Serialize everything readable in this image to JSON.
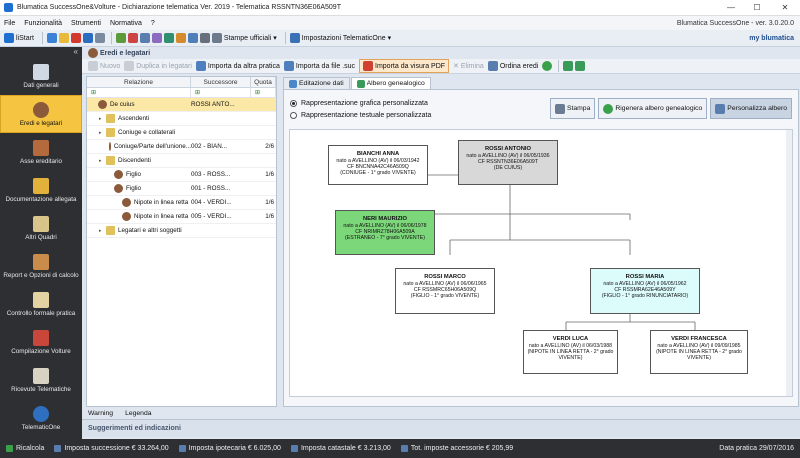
{
  "window": {
    "title": "Blumatica SuccessOne&Volture - Dichiarazione telematica Ver. 2019 - Telematica RSSNTN36E06A509T",
    "controls": {
      "minimize": "—",
      "maximize": "☐",
      "close": "✕"
    }
  },
  "menu": {
    "items": [
      "File",
      "Funzionalità",
      "Strumenti",
      "Normativa",
      "?"
    ],
    "version": "Blumatica SuccessOne - ver. 3.0.20.0"
  },
  "toolbar": {
    "start": "liStart",
    "stampe": "Stampe ufficiali",
    "impostazioni": "Impostazioni TelematicOne",
    "brand": "my blumatica"
  },
  "sidebar": {
    "collapse": "«",
    "items": [
      {
        "label": "Dati generali",
        "active": false,
        "icon": "document-icon"
      },
      {
        "label": "Eredi e legatari",
        "active": true,
        "icon": "person-icon"
      },
      {
        "label": "Asse ereditario",
        "active": false,
        "icon": "house-icon"
      },
      {
        "label": "Documentazione allegata",
        "active": false,
        "icon": "folder-icon"
      },
      {
        "label": "Altri Quadri",
        "active": false,
        "icon": "clipboard-icon"
      },
      {
        "label": "Report e Opzioni di calcolo",
        "active": false,
        "icon": "report-icon"
      },
      {
        "label": "Controllo formale pratica",
        "active": false,
        "icon": "checklist-icon"
      },
      {
        "label": "Compilazione Volture",
        "active": false,
        "icon": "tools-icon"
      },
      {
        "label": "Ricevute Telematiche",
        "active": false,
        "icon": "mail-icon"
      },
      {
        "label": "TelematicOne",
        "active": false,
        "icon": "telematic-icon"
      }
    ]
  },
  "content": {
    "header": "Eredi e legatari",
    "toolbar": {
      "nuovo": "Nuovo",
      "duplica": "Duplica in legatari",
      "importa_altra": "Importa da altra pratica",
      "importa_file": "Importa da file .suc",
      "importa_pdf": "Importa da visura PDF",
      "elimina": "Elimina",
      "ordina": "Ordina eredi"
    }
  },
  "tree": {
    "columns": {
      "relazione": "Relazione",
      "successore": "Successore",
      "quota": "Quota"
    },
    "rows": [
      {
        "rel": "De cuius",
        "succ": "ROSSI ANTO...",
        "quota": "",
        "indent": 0,
        "selected": true
      },
      {
        "rel": "Ascendenti",
        "succ": "",
        "quota": "",
        "indent": 1,
        "selected": false
      },
      {
        "rel": "Coniuge e collaterali",
        "succ": "",
        "quota": "",
        "indent": 1,
        "selected": false
      },
      {
        "rel": "Coniuge/Parte dell'unione...",
        "succ": "002 - BIAN...",
        "quota": "2/6",
        "indent": 2,
        "selected": false
      },
      {
        "rel": "Discendenti",
        "succ": "",
        "quota": "",
        "indent": 1,
        "selected": false
      },
      {
        "rel": "Figlio",
        "succ": "003 - ROSS...",
        "quota": "1/6",
        "indent": 2,
        "selected": false
      },
      {
        "rel": "Figlio",
        "succ": "001 - ROSS...",
        "quota": "",
        "indent": 2,
        "selected": false
      },
      {
        "rel": "Nipote in linea retta",
        "succ": "004 - VERDI...",
        "quota": "1/6",
        "indent": 3,
        "selected": false
      },
      {
        "rel": "Nipote in linea retta",
        "succ": "005 - VERDI...",
        "quota": "1/6",
        "indent": 3,
        "selected": false
      },
      {
        "rel": "Legatari e altri soggetti",
        "succ": "",
        "quota": "",
        "indent": 1,
        "selected": false
      }
    ]
  },
  "tabs": {
    "edit": "Editazione dati",
    "tree": "Albero genealogico"
  },
  "options": {
    "grafica": "Rappresentazione grafica personalizzata",
    "testuale": "Rappresentazione testuale personalizzata",
    "stampa": "Stampa",
    "rigenera": "Rigenera albero genealogico",
    "personalizza": "Personalizza albero"
  },
  "persons": [
    {
      "id": "bianchi",
      "name": "BIANCHI ANNA",
      "l1": "nato a AVELLINO (AV) il 06/03/1942",
      "l2": "CF BNCNNA42C46A509Q",
      "l3": "(CONIUGE - 1° grado VIVENTE)",
      "style": "white"
    },
    {
      "id": "rossi_antonio",
      "name": "ROSSI ANTONIO",
      "l1": "nato a AVELLINO (AV) il 06/05/1936",
      "l2": "CF RSSNTN36E06A509T",
      "l3": "(DE CUIUS)",
      "style": "gray"
    },
    {
      "id": "neri",
      "name": "NERI MAURIZIO",
      "l1": "nato a AVELLINO (AV) il 06/06/1978",
      "l2": "CF NRIMRZ78H06A509A",
      "l3": "(ESTRANEO - 7° grado VIVENTE)",
      "style": "green"
    },
    {
      "id": "rossi_marco",
      "name": "ROSSI MARCO",
      "l1": "nato a AVELLINO (AV) il 06/06/1965",
      "l2": "CF RSSMRC65H06A509Q",
      "l3": "(FIGLIO - 1° grado VIVENTE)",
      "style": "white"
    },
    {
      "id": "rossi_maria",
      "name": "ROSSI MARIA",
      "l1": "nato a AVELLINO (AV) il 06/05/1962",
      "l2": "CF RSSMRA62E46A509Y",
      "l3": "(FIGLIO - 1° grado RINUNCIATARIO)",
      "style": "cyan"
    },
    {
      "id": "verdi_luca",
      "name": "VERDI LUCA",
      "l1": "nato a AVELLINO (AV) il 06/03/1988",
      "l2": "(NIPOTE IN LINEA RETTA - 2° grado",
      "l3": "VIVENTE)",
      "style": "white"
    },
    {
      "id": "verdi_francesca",
      "name": "VERDI FRANCESCA",
      "l1": "nato a AVELLINO (AV) il 09/09/1985",
      "l2": "(NIPOTE IN LINEA RETTA - 2° grado",
      "l3": "VIVENTE)",
      "style": "white"
    }
  ],
  "bottom": {
    "warning": "Warning",
    "legenda": "Legenda",
    "suggerimenti": "Suggerimenti ed indicazioni"
  },
  "status": {
    "ricalcola": "Ricalcola",
    "imposta_successione": "Imposta successione € 33.264,00",
    "imposta_ipotecaria": "Imposta ipotecaria € 6.025,00",
    "imposta_catastale": "Imposta catastale € 3.213,00",
    "imposte_accessorie": "Tot. imposte accessorie € 205,99",
    "data_pratica": "Data pratica 29/07/2016"
  },
  "colors": {
    "accent_sidebar": "#f5c542",
    "sidebar_bg": "#2d2f33",
    "green_box": "#7cd67a",
    "cyan_box": "#dcfbfb"
  }
}
